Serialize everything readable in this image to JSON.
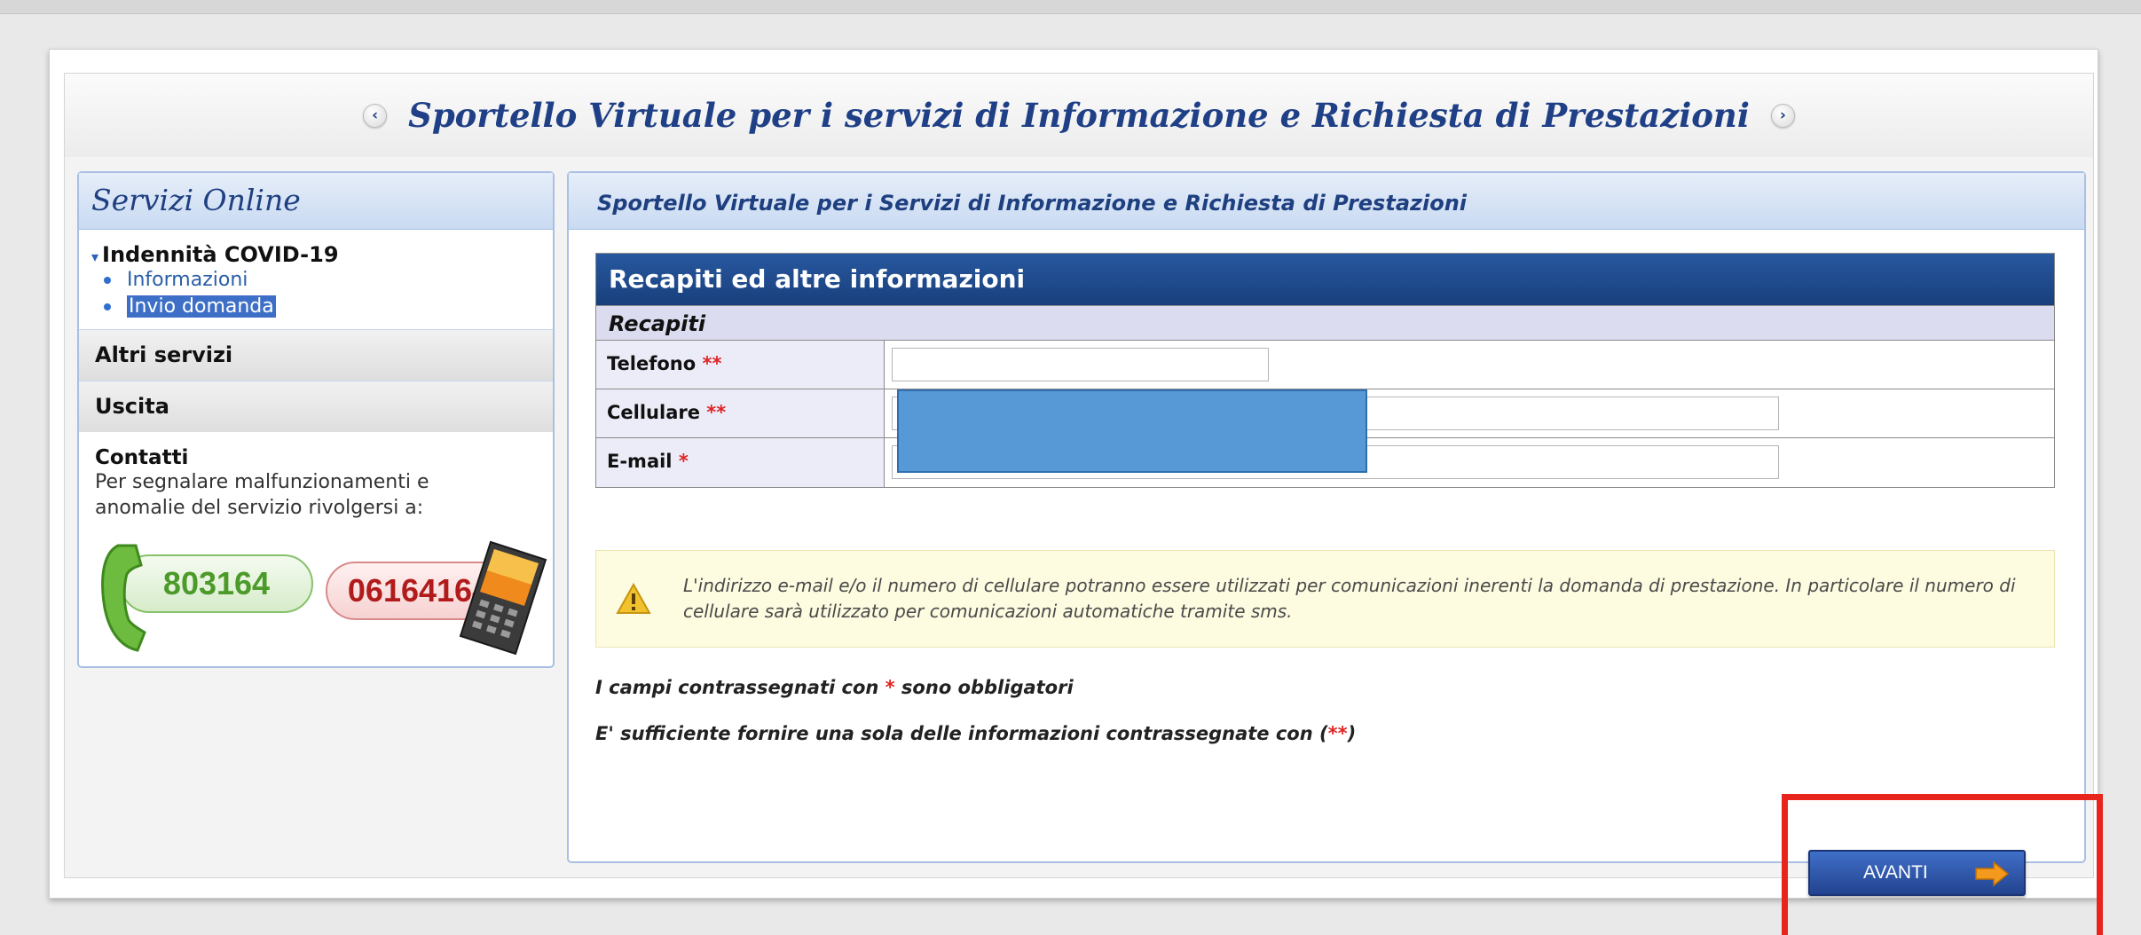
{
  "banner": {
    "title": "Sportello Virtuale per i servizi di Informazione e Richiesta di Prestazioni",
    "prev_glyph": "‹",
    "next_glyph": "›"
  },
  "sidebar": {
    "title": "Servizi Online",
    "group": {
      "caret": "▾",
      "label": "Indennità COVID-19",
      "links": [
        {
          "label": "Informazioni",
          "selected": false
        },
        {
          "label": "Invio domanda",
          "selected": true
        }
      ]
    },
    "items": [
      {
        "label": "Altri servizi"
      },
      {
        "label": "Uscita"
      }
    ],
    "contacts": {
      "title": "Contatti",
      "text": "Per segnalare malfunzionamenti e anomalie del servizio rivolgersi a:",
      "landline": "803164",
      "mobile": "06164164"
    }
  },
  "main": {
    "header": "Sportello Virtuale per i Servizi di Informazione e Richiesta di Prestazioni",
    "form": {
      "title": "Recapiti ed altre informazioni",
      "section": "Recapiti",
      "rows": [
        {
          "label": "Telefono",
          "req": "**",
          "value": ""
        },
        {
          "label": "Cellulare",
          "req": "**",
          "value": ""
        },
        {
          "label": "E-mail",
          "req": "*",
          "value": ""
        }
      ]
    },
    "warning": "L'indirizzo e-mail e/o il numero di cellulare potranno essere utilizzati per comunicazioni inerenti la domanda di prestazione. In particolare il numero di cellulare sarà utilizzato per comunicazioni automatiche tramite sms.",
    "note1": {
      "before": "I campi contrassegnati con ",
      "mark": "*",
      "after": " sono obbligatori"
    },
    "note2": {
      "before": "E' sufficiente fornire una sola delle informazioni contrassegnate con (",
      "mark": "**",
      "after": ")"
    },
    "next_button": "AVANTI"
  },
  "colors": {
    "accent": "#1f3f86",
    "required": "#e02424",
    "highlight_box": "#e8251d",
    "redaction": "#5699d6"
  },
  "icons": [
    "chevron-left-icon",
    "chevron-right-icon",
    "caret-down-icon",
    "bullet-icon",
    "phone-handset-icon",
    "mobile-phone-icon",
    "warning-icon",
    "arrow-right-icon"
  ]
}
